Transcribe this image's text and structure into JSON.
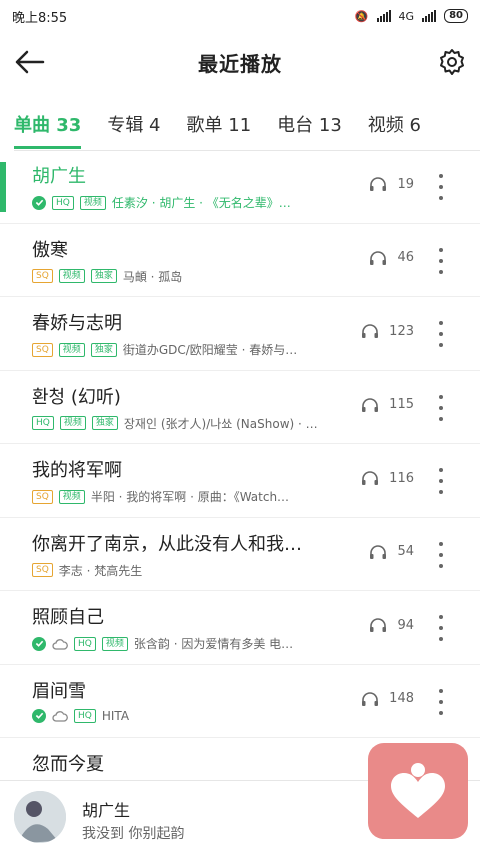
{
  "statusbar": {
    "time": "晚上8:55",
    "network": "4G",
    "battery": "80"
  },
  "header": {
    "title": "最近播放"
  },
  "tabs": [
    {
      "label": "单曲 33",
      "active": true
    },
    {
      "label": "专辑 4",
      "active": false
    },
    {
      "label": "歌单 11",
      "active": false
    },
    {
      "label": "电台 13",
      "active": false
    },
    {
      "label": "视频 6",
      "active": false
    }
  ],
  "songs": [
    {
      "title": "胡广生",
      "meta": "任素汐 · 胡广生 · 《无名之辈》…",
      "plays": "19"
    },
    {
      "title": "傲寒",
      "meta": "马頔 · 孤岛",
      "plays": "46"
    },
    {
      "title": "春娇与志明",
      "meta": "街道办GDC/欧阳耀莹 · 春娇与…",
      "plays": "123"
    },
    {
      "title": "환청 (幻听)",
      "meta": "장재인 (张才人)/나쑈 (NaShow) · …",
      "plays": "115"
    },
    {
      "title": "我的将军啊",
      "meta": "半阳 · 我的将军啊 · 原曲：《Watch…",
      "plays": "116"
    },
    {
      "title": "你离开了南京，从此没有人和我…",
      "meta": "李志 · 梵高先生",
      "plays": "54"
    },
    {
      "title": "照顾自己",
      "meta": "张含韵 · 因为爱情有多美 电…",
      "plays": "94"
    },
    {
      "title": "眉间雪",
      "meta": "HITA",
      "plays": "148"
    },
    {
      "title": "忽而今夏",
      "meta": "",
      "plays": ""
    }
  ],
  "badges": {
    "hq": "HQ",
    "sq": "SQ",
    "video": "视频",
    "exclusive": "独家"
  },
  "player": {
    "song": "胡广生",
    "lyric": "我没到 你别起韵"
  },
  "colors": {
    "accent": "#2fb86b",
    "sq": "#e6a532",
    "heart_bg": "#e98a89"
  }
}
